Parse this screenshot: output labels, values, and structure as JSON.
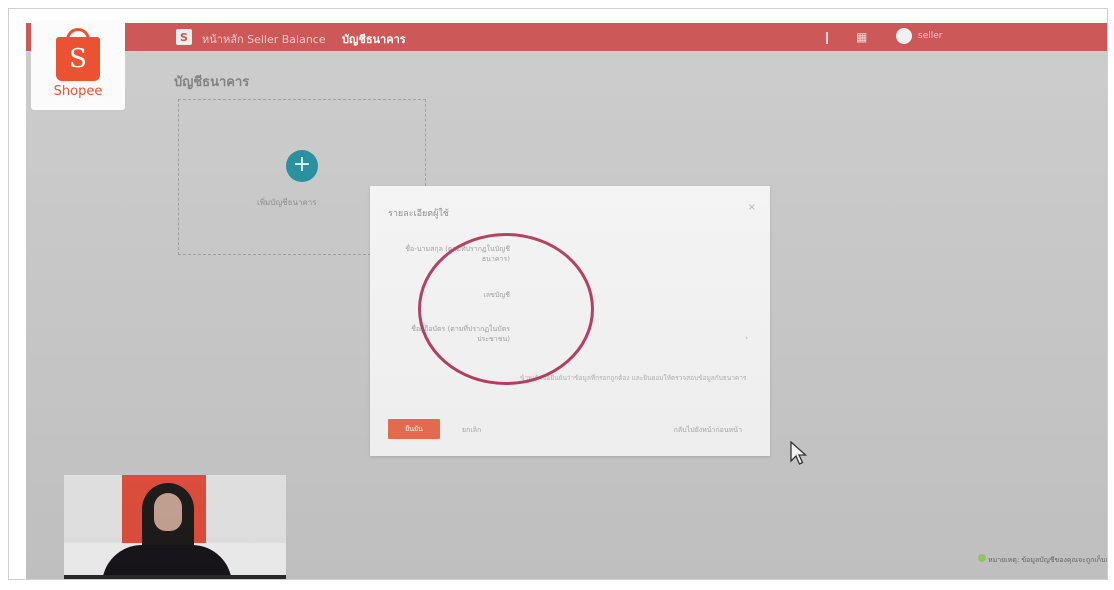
{
  "brand": {
    "name": "Shopee",
    "initial": "S",
    "color": "#ea5232"
  },
  "topbar": {
    "logo_initial": "S",
    "breadcrumb_parent": "หน้าหลัก Seller Balance",
    "breadcrumb_current": "บัญชีธนาคาร",
    "icon_bell": "bell-icon",
    "icon_apps": "grid-icon",
    "username": "seller",
    "color": "#c94a4a"
  },
  "page": {
    "heading": "บัญชีธนาคาร",
    "add_card_label": "เพิ่มบัญชีธนาคาร",
    "add_icon": "+"
  },
  "modal": {
    "title": "รายละเอียดผู้ใช้",
    "close_icon": "×",
    "field_1": "ชื่อ-นามสกุล (ตามที่ปรากฏในบัญชีธนาคาร)",
    "field_2": "เลขบัญชี",
    "field_3": "ชื่อผู้ถือบัตร (ตามที่ปรากฏในบัตรประชาชน)",
    "note": "ข้าพเจ้าขอยืนยันว่าข้อมูลที่กรอกถูกต้อง และยินยอมให้ตรวจสอบข้อมูลกับธนาคาร",
    "mark": "›",
    "confirm_label": "ยืนยัน",
    "cancel_label": "ยกเลิก",
    "back_label": "กลับไปยังหน้าก่อนหน้า"
  },
  "toast": {
    "text": "หมายเหตุ: ข้อมูลบัญชีของคุณจะถูกเก็บเป็นความลับ"
  }
}
